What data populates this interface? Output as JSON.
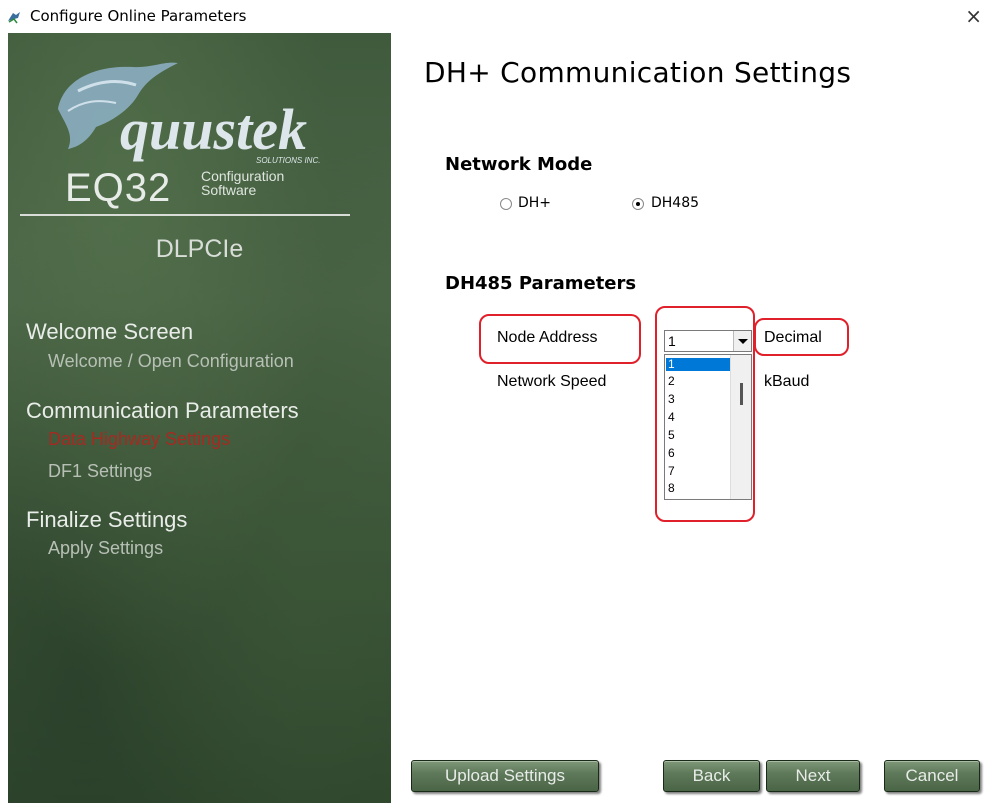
{
  "window": {
    "title": "Configure Online Parameters",
    "close_glyph": "×"
  },
  "sidebar": {
    "logo_text": "quustek",
    "logo_subtext": "SOLUTIONS INC.",
    "app_name": "EQ32",
    "app_sub_line1": "Configuration",
    "app_sub_line2": "Software",
    "product": "DLPCIe",
    "sections": [
      {
        "heading": "Welcome Screen",
        "items": [
          {
            "label": "Welcome / Open Configuration"
          }
        ]
      },
      {
        "heading": "Communication Parameters",
        "items": [
          {
            "label": "Data Highway Settings"
          },
          {
            "label": "DF1 Settings"
          }
        ]
      },
      {
        "heading": "Finalize Settings",
        "items": [
          {
            "label": "Apply Settings"
          }
        ]
      }
    ]
  },
  "main": {
    "title": "DH+ Communication Settings",
    "network_mode": {
      "heading": "Network Mode",
      "options": [
        {
          "label": "DH+",
          "checked": false
        },
        {
          "label": "DH485",
          "checked": true
        }
      ]
    },
    "params": {
      "heading": "DH485 Parameters",
      "node_address_label": "Node Address",
      "node_address_value": "1",
      "node_address_unit": "Decimal",
      "network_speed_label": "Network Speed",
      "network_speed_unit": "kBaud",
      "dropdown_options": [
        "1",
        "2",
        "3",
        "4",
        "5",
        "6",
        "7",
        "8"
      ]
    }
  },
  "buttons": {
    "upload": "Upload Settings",
    "back": "Back",
    "next": "Next",
    "cancel": "Cancel"
  },
  "colors": {
    "accent_red": "#e0202a",
    "active_nav": "#a52a22",
    "selection": "#0078d7"
  }
}
